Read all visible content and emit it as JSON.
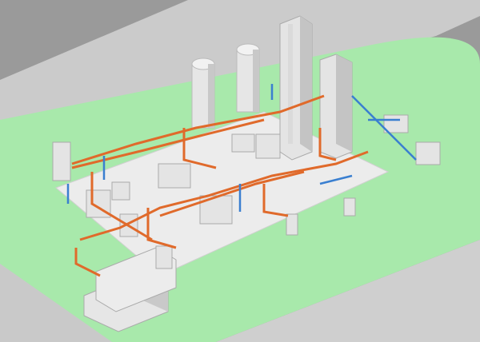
{
  "scene": {
    "description_visible_text": "",
    "colors": {
      "background": "#9a9a9a",
      "road": "#c8c8c8",
      "grass": "#a6e8a9",
      "slab": "#e9e9e9",
      "equipment": "#e4e4e4",
      "equipment_shade": "#bdbdbd",
      "pipe_orange": "#e06a2b",
      "pipe_blue": "#3a7fd0"
    }
  }
}
